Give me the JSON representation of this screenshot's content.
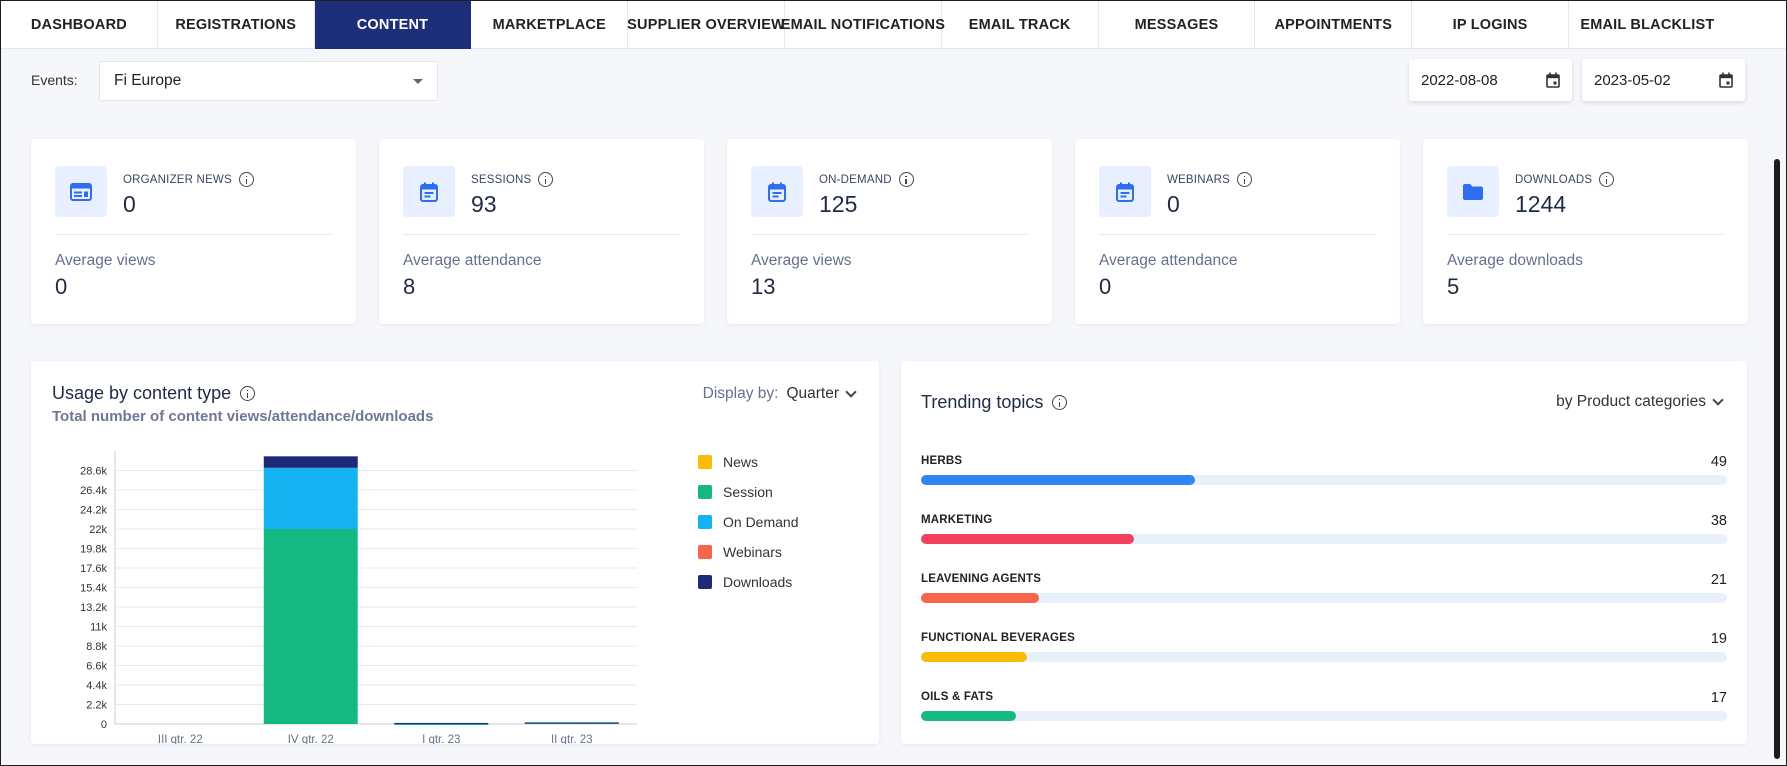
{
  "nav": {
    "tabs": [
      {
        "label": "DASHBOARD"
      },
      {
        "label": "REGISTRATIONS"
      },
      {
        "label": "CONTENT"
      },
      {
        "label": "MARKETPLACE"
      },
      {
        "label": "SUPPLIER OVERVIEW"
      },
      {
        "label": "EMAIL NOTIFICATIONS"
      },
      {
        "label": "EMAIL TRACK"
      },
      {
        "label": "MESSAGES"
      },
      {
        "label": "APPOINTMENTS"
      },
      {
        "label": "IP LOGINS"
      },
      {
        "label": "EMAIL BLACKLIST"
      }
    ],
    "active_index": 2,
    "active_color": "#1e2f7a"
  },
  "filters": {
    "events_label": "Events:",
    "event_value": "Fi Europe",
    "date_from": "2022-08-08",
    "date_to": "2023-05-02"
  },
  "cards": [
    {
      "icon": "newspaper-icon",
      "label": "ORGANIZER NEWS",
      "value": "0",
      "sub_label": "Average views",
      "sub_value": "0"
    },
    {
      "icon": "calendar-icon",
      "label": "SESSIONS",
      "value": "93",
      "sub_label": "Average attendance",
      "sub_value": "8"
    },
    {
      "icon": "calendar-icon",
      "label": "ON-DEMAND",
      "value": "125",
      "sub_label": "Average views",
      "sub_value": "13"
    },
    {
      "icon": "calendar-icon",
      "label": "WEBINARS",
      "value": "0",
      "sub_label": "Average attendance",
      "sub_value": "0"
    },
    {
      "icon": "folder-icon",
      "label": "DOWNLOADS",
      "value": "1244",
      "sub_label": "Average downloads",
      "sub_value": "5"
    }
  ],
  "usage": {
    "title": "Usage by content type",
    "subtitle": "Total number of content views/attendance/downloads",
    "display_by_label": "Display by:",
    "display_by_value": "Quarter"
  },
  "chart_data": {
    "type": "bar",
    "stacked": true,
    "categories": [
      "III qtr. 22",
      "IV qtr. 22",
      "I qtr. 23",
      "II qtr. 23"
    ],
    "series": [
      {
        "name": "News",
        "color": "#fbbc05",
        "values": [
          0,
          0,
          0,
          0
        ]
      },
      {
        "name": "Session",
        "color": "#14b981",
        "values": [
          0,
          22000,
          30,
          150
        ]
      },
      {
        "name": "On Demand",
        "color": "#15b3f2",
        "values": [
          0,
          6900,
          30,
          20
        ]
      },
      {
        "name": "Webinars",
        "color": "#f7644a",
        "values": [
          0,
          0,
          0,
          0
        ]
      },
      {
        "name": "Downloads",
        "color": "#1e2a78",
        "values": [
          0,
          1300,
          60,
          10
        ]
      }
    ],
    "yticks": [
      "0",
      "2.2k",
      "4.4k",
      "6.6k",
      "8.8k",
      "11k",
      "13.2k",
      "15.4k",
      "17.6k",
      "19.8k",
      "22k",
      "24.2k",
      "26.4k",
      "28.6k"
    ],
    "ylim": [
      0,
      30800
    ],
    "ytick_step": 2200,
    "grid": true,
    "legend_position": "right"
  },
  "trending": {
    "title": "Trending topics",
    "filter_value": "by Product categories",
    "max_value": 144,
    "topics": [
      {
        "name": "HERBS",
        "value": "49",
        "color": "#2f86f6"
      },
      {
        "name": "MARKETING",
        "value": "38",
        "color": "#f0405e"
      },
      {
        "name": "LEAVENING AGENTS",
        "value": "21",
        "color": "#f7644a"
      },
      {
        "name": "FUNCTIONAL BEVERAGES",
        "value": "19",
        "color": "#fbbc05"
      },
      {
        "name": "OILS & FATS",
        "value": "17",
        "color": "#14b981"
      }
    ]
  }
}
